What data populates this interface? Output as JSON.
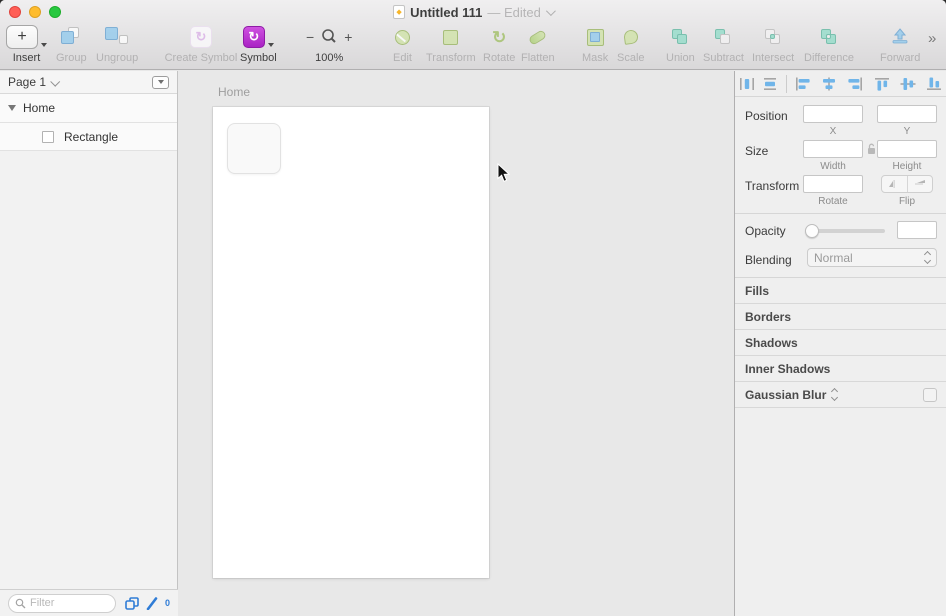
{
  "window": {
    "title": "Untitled 111",
    "edited": "— Edited"
  },
  "toolbar": {
    "insert": "Insert",
    "group": "Group",
    "ungroup": "Ungroup",
    "create_symbol": "Create Symbol",
    "symbol": "Symbol",
    "zoom": "100%",
    "edit": "Edit",
    "transform": "Transform",
    "rotate": "Rotate",
    "flatten": "Flatten",
    "mask": "Mask",
    "scale": "Scale",
    "union": "Union",
    "subtract": "Subtract",
    "intersect": "Intersect",
    "difference": "Difference",
    "forward": "Forward"
  },
  "icons": {
    "plus": "+",
    "minus": "−",
    "rotate_cw": "↻",
    "double_chevron": "»",
    "diamond": "◆"
  },
  "sidebar": {
    "page": "Page 1",
    "artboard": "Home",
    "layer": "Rectangle",
    "filter_placeholder": "Filter",
    "slice_count": "0"
  },
  "canvas": {
    "artboard_label": "Home"
  },
  "inspector": {
    "position": "Position",
    "x": "X",
    "y": "Y",
    "size": "Size",
    "width": "Width",
    "height": "Height",
    "transform": "Transform",
    "rotate": "Rotate",
    "flip": "Flip",
    "opacity": "Opacity",
    "blending": "Blending",
    "blending_value": "Normal",
    "sections": {
      "fills": "Fills",
      "borders": "Borders",
      "shadows": "Shadows",
      "inner_shadows": "Inner Shadows",
      "gaussian_blur": "Gaussian Blur"
    }
  },
  "colors": {
    "accent_blue": "#70b5e9",
    "symbol_purple": "#bb2fd1",
    "tool_green": "#cfe3a4",
    "tool_teal": "#8fdcc8",
    "traffic_red": "#ff5f57",
    "traffic_yellow": "#febc2e",
    "traffic_green": "#28c840"
  }
}
